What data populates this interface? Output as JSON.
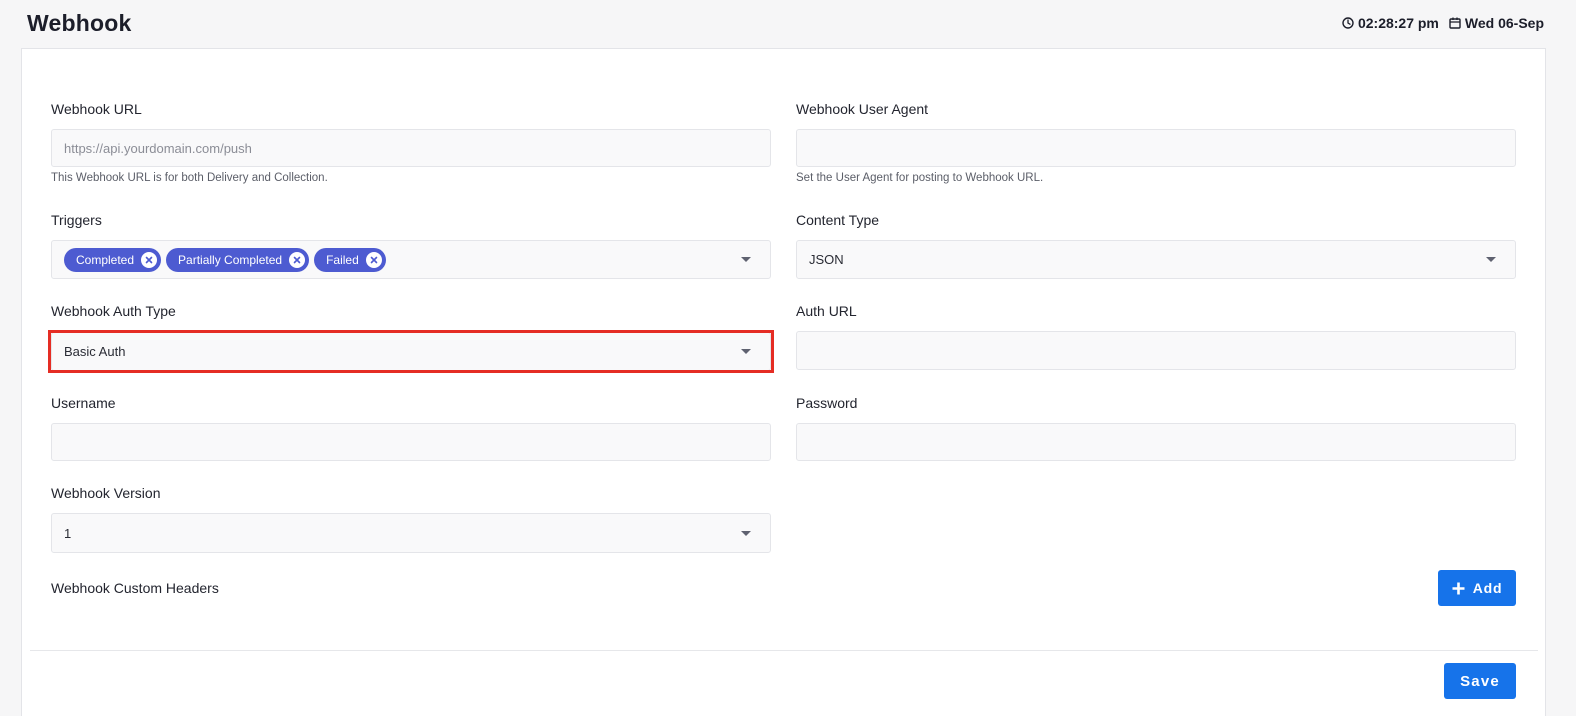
{
  "header": {
    "title": "Webhook",
    "time": "02:28:27 pm",
    "date": "Wed 06-Sep"
  },
  "form": {
    "webhook_url": {
      "label": "Webhook URL",
      "placeholder": "https://api.yourdomain.com/push",
      "help": "This Webhook URL is for both Delivery and Collection."
    },
    "user_agent": {
      "label": "Webhook User Agent",
      "value": "",
      "help": "Set the User Agent for posting to Webhook URL."
    },
    "triggers": {
      "label": "Triggers",
      "chips": [
        "Completed",
        "Partially Completed",
        "Failed"
      ]
    },
    "content_type": {
      "label": "Content Type",
      "value": "JSON"
    },
    "auth_type": {
      "label": "Webhook Auth Type",
      "value": "Basic Auth"
    },
    "auth_url": {
      "label": "Auth URL",
      "value": ""
    },
    "username": {
      "label": "Username",
      "value": ""
    },
    "password": {
      "label": "Password",
      "value": ""
    },
    "version": {
      "label": "Webhook Version",
      "value": "1"
    },
    "custom_headers": {
      "label": "Webhook Custom Headers",
      "add_label": "Add"
    },
    "save_label": "Save"
  },
  "icons": {
    "clock": "clock-icon",
    "calendar": "calendar-icon",
    "chip_remove": "close-circle-icon",
    "dropdown": "caret-down-icon",
    "add": "plus-icon"
  },
  "colors": {
    "accent": "#1673ea",
    "chip": "#4d5bd1",
    "highlight": "#e52d24"
  }
}
